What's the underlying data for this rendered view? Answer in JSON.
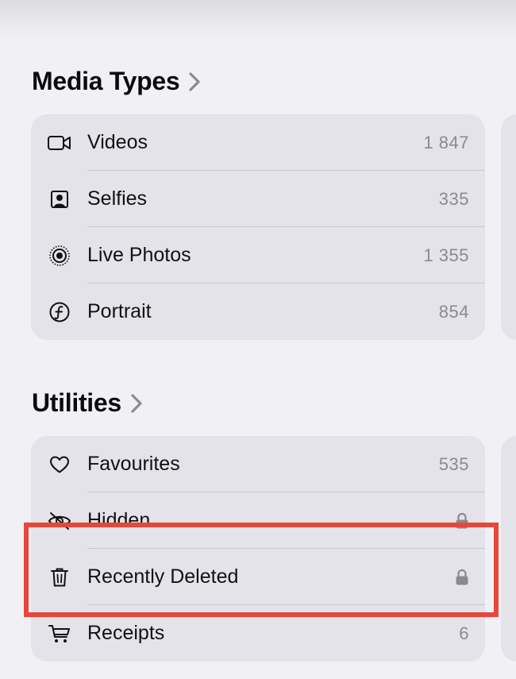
{
  "media_types": {
    "title": "Media Types",
    "items": [
      {
        "label": "Videos",
        "count": "1 847",
        "icon": "video-camera-icon"
      },
      {
        "label": "Selfies",
        "count": "335",
        "icon": "selfie-portrait-icon"
      },
      {
        "label": "Live Photos",
        "count": "1 355",
        "icon": "live-photo-icon"
      },
      {
        "label": "Portrait",
        "count": "854",
        "icon": "portrait-aperture-icon"
      }
    ]
  },
  "utilities": {
    "title": "Utilities",
    "items": [
      {
        "label": "Favourites",
        "count": "535",
        "icon": "heart-icon"
      },
      {
        "label": "Hidden",
        "count": "",
        "icon": "eye-slash-icon",
        "locked": true
      },
      {
        "label": "Recently Deleted",
        "count": "",
        "icon": "trash-icon",
        "locked": true
      },
      {
        "label": "Receipts",
        "count": "6",
        "icon": "cart-icon"
      }
    ]
  },
  "colors": {
    "background": "#f1f0f5",
    "card": "#e4e3e9",
    "highlight": "#e8463a",
    "secondary_text": "#8a8a8f"
  }
}
